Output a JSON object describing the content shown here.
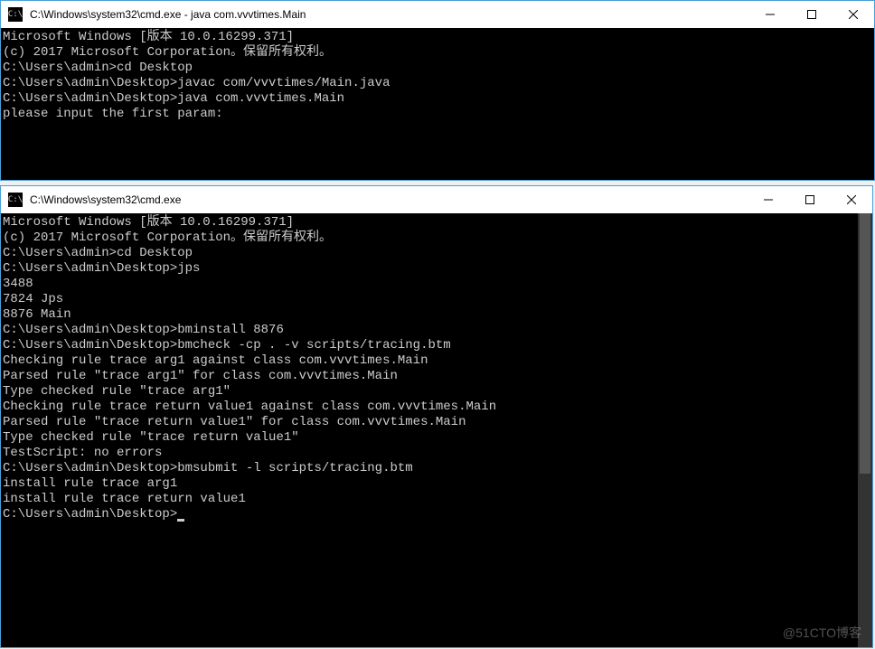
{
  "window1": {
    "title": "C:\\Windows\\system32\\cmd.exe - java  com.vvvtimes.Main",
    "lines": [
      "Microsoft Windows [版本 10.0.16299.371]",
      "(c) 2017 Microsoft Corporation。保留所有权利。",
      "",
      "C:\\Users\\admin>cd Desktop",
      "",
      "C:\\Users\\admin\\Desktop>javac com/vvvtimes/Main.java",
      "",
      "C:\\Users\\admin\\Desktop>java com.vvvtimes.Main",
      "please input the first param:"
    ]
  },
  "window2": {
    "title": "C:\\Windows\\system32\\cmd.exe",
    "lines": [
      "Microsoft Windows [版本 10.0.16299.371]",
      "(c) 2017 Microsoft Corporation。保留所有权利。",
      "",
      "C:\\Users\\admin>cd Desktop",
      "",
      "C:\\Users\\admin\\Desktop>jps",
      "3488",
      "7824 Jps",
      "8876 Main",
      "",
      "C:\\Users\\admin\\Desktop>bminstall 8876",
      "",
      "C:\\Users\\admin\\Desktop>bmcheck -cp . -v scripts/tracing.btm",
      "Checking rule trace arg1 against class com.vvvtimes.Main",
      "Parsed rule \"trace arg1\" for class com.vvvtimes.Main",
      "Type checked rule \"trace arg1\"",
      "",
      "Checking rule trace return value1 against class com.vvvtimes.Main",
      "Parsed rule \"trace return value1\" for class com.vvvtimes.Main",
      "Type checked rule \"trace return value1\"",
      "",
      "TestScript: no errors",
      "",
      "C:\\Users\\admin\\Desktop>bmsubmit -l scripts/tracing.btm",
      "install rule trace arg1",
      "install rule trace return value1",
      "",
      "C:\\Users\\admin\\Desktop>"
    ]
  },
  "watermark": "@51CTO博客"
}
